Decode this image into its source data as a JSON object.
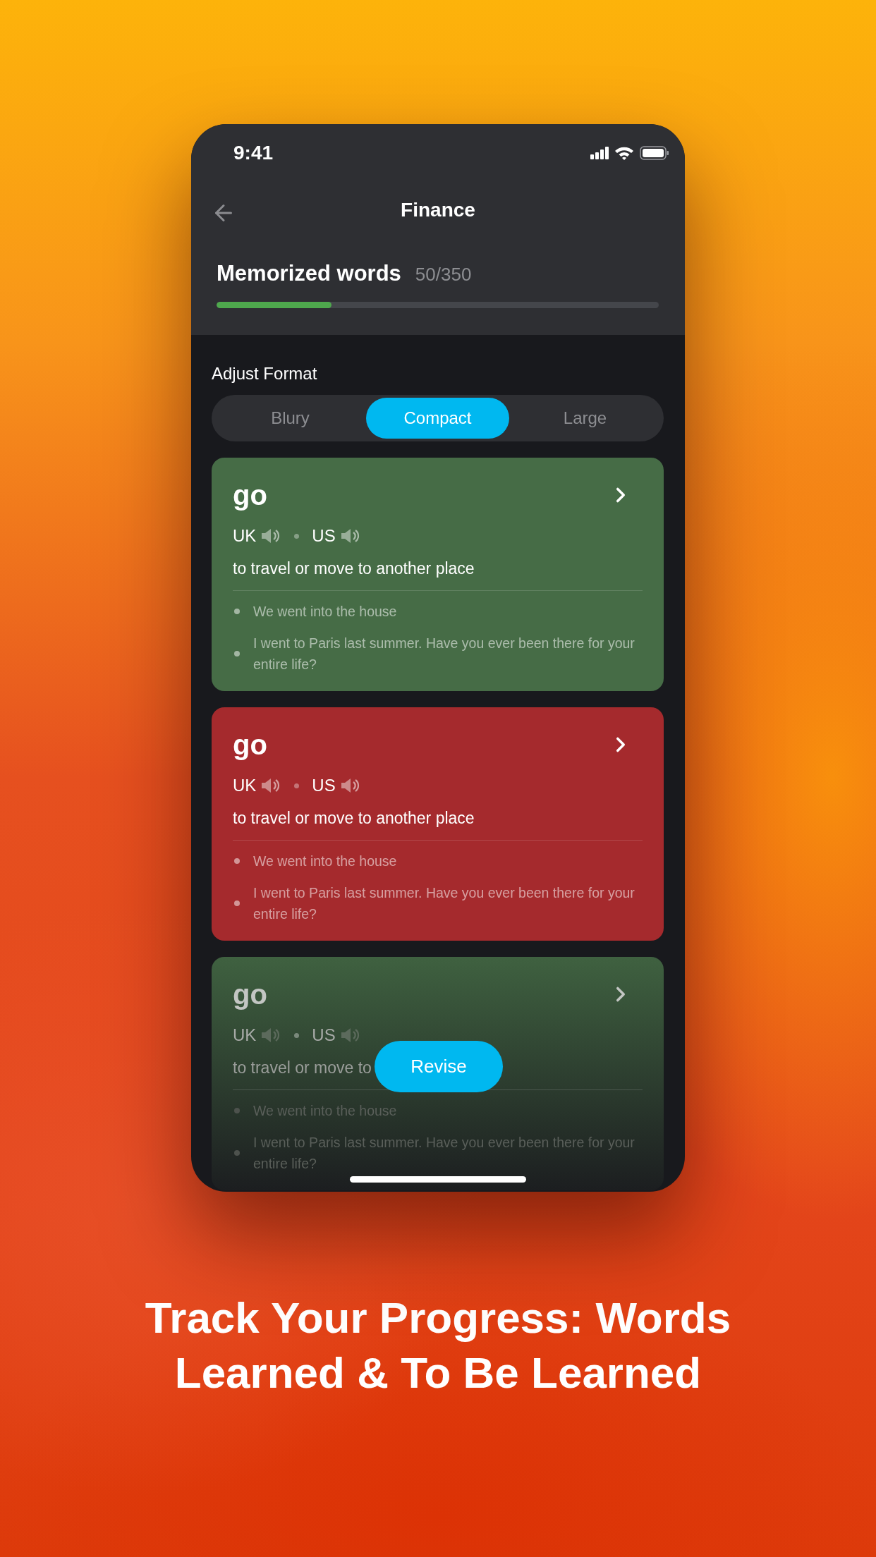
{
  "status_bar": {
    "time": "9:41"
  },
  "nav": {
    "title": "Finance"
  },
  "progress": {
    "label": "Memorized words",
    "count": "50/350",
    "level": 0.26
  },
  "format": {
    "label": "Adjust Format",
    "options": [
      {
        "label": "Blury",
        "selected": false
      },
      {
        "label": "Compact",
        "selected": true
      },
      {
        "label": "Large",
        "selected": false
      }
    ]
  },
  "cards": [
    {
      "word": "go",
      "pronunciations": [
        "UK",
        "US"
      ],
      "definition": "to travel or move to another place",
      "examples": [
        "We went into the house",
        "I went to Paris last summer. Have you ever been there for your entire life?"
      ],
      "color": "#466c46",
      "faded": false
    },
    {
      "word": "go",
      "pronunciations": [
        "UK",
        "US"
      ],
      "definition": "to travel or move to another place",
      "examples": [
        "We went into the house",
        "I went to Paris last summer. Have you ever been there for your entire life?"
      ],
      "color": "#a52a2d",
      "faded": false
    },
    {
      "word": "go",
      "pronunciations": [
        "UK",
        "US"
      ],
      "definition": "to travel or move to",
      "examples": [
        "We went into the house",
        "I went to Paris last summer. Have you ever been there for your entire life?"
      ],
      "color": "#3f6140",
      "faded": true
    }
  ],
  "revise_button": {
    "label": "Revise"
  },
  "headline": "Track Your Progress: Words Learned & To Be Learned"
}
